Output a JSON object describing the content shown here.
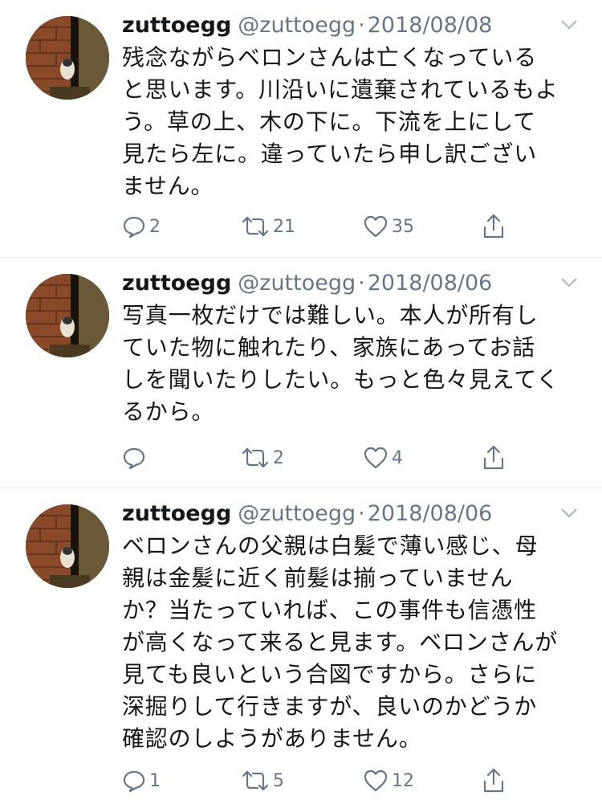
{
  "tweets": [
    {
      "name": "zuttoegg",
      "handle": "@zuttoegg",
      "dot": "·",
      "date": "2018/08/08",
      "lines": [
        "残念ながらベロンさんは亡くなっている",
        "と思います。川沿いに遺棄されているもよ",
        "う。草の上、木の下に。下流を上にして",
        "見たら左に。違っていたら申し訳ござい",
        "ません。"
      ],
      "replies": "2",
      "retweets": "21",
      "likes": "35"
    },
    {
      "name": "zuttoegg",
      "handle": "@zuttoegg",
      "dot": "·",
      "date": "2018/08/06",
      "lines": [
        "写真一枚だけでは難しい。本人が所有し",
        "ていた物に触れたり、家族にあってお話",
        "しを聞いたりしたい。もっと色々見えてく",
        "るから。"
      ],
      "replies": "",
      "retweets": "2",
      "likes": "4"
    },
    {
      "name": "zuttoegg",
      "handle": "@zuttoegg",
      "dot": "·",
      "date": "2018/08/06",
      "lines": [
        "ベロンさんの父親は白髪で薄い感じ、母",
        "親は金髪に近く前髪は揃っていません",
        "か？当たっていれば、この事件も信憑性",
        "が高くなって来ると見ます。ベロンさんが",
        "見ても良いという合図ですから。さらに",
        "深掘りして行きますが、良いのかどうか",
        "確認のしようがありません。"
      ],
      "replies": "1",
      "retweets": "5",
      "likes": "12"
    }
  ],
  "colors": {
    "text": "#14171a",
    "secondary": "#657786",
    "divider": "#e6ecf0"
  },
  "icons": [
    "reply-icon",
    "retweet-icon",
    "like-icon",
    "share-icon",
    "chevron-down-icon",
    "avatar-photo"
  ]
}
